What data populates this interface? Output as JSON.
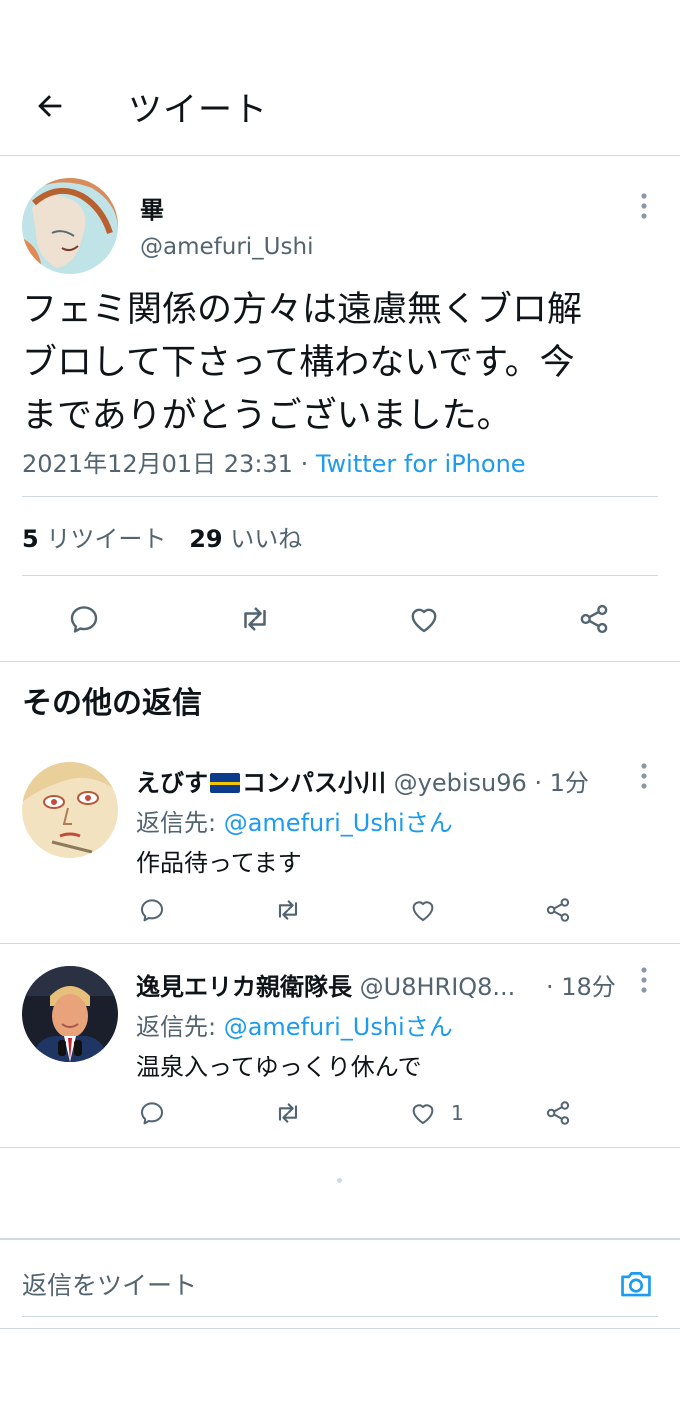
{
  "header": {
    "title": "ツイート"
  },
  "tweet": {
    "name": "畢",
    "handle": "@amefuri_Ushi",
    "text": "フェミ関係の方々は遠慮無くブロ解\nブロして下さって構わないです。今\nまでありがとうございました。",
    "timestamp": "2021年12月01日 23:31 · ",
    "source": "Twitter for iPhone",
    "retweets_count": "5",
    "retweets_label": " リツイート",
    "likes_count": "29",
    "likes_label": " いいね"
  },
  "replies_section": {
    "title": "その他の返信"
  },
  "replies": [
    {
      "name_part1": "えびす",
      "name_part2": "コンパス小川",
      "handle": " @yebisu96",
      "time": " · 1分",
      "reply_to_label": "返信先: ",
      "reply_to_handle": "@amefuri_Ushiさん",
      "text": "作品待ってます",
      "like_count": ""
    },
    {
      "name": "逸見エリカ親衛隊長",
      "handle": " @U8HRIQ8...",
      "time": " · 18分",
      "reply_to_label": "返信先: ",
      "reply_to_handle": "@amefuri_Ushiさん",
      "text": "温泉入ってゆっくり休んで",
      "like_count": "1"
    }
  ],
  "compose": {
    "placeholder": "返信をツイート"
  },
  "colors": {
    "accent": "#1d9bf0",
    "text": "#0f1419",
    "muted": "#536471",
    "border": "#cfd9de"
  },
  "icons": [
    "back-arrow-icon",
    "more-icon",
    "reply-icon",
    "retweet-icon",
    "like-icon",
    "share-icon",
    "camera-icon"
  ]
}
